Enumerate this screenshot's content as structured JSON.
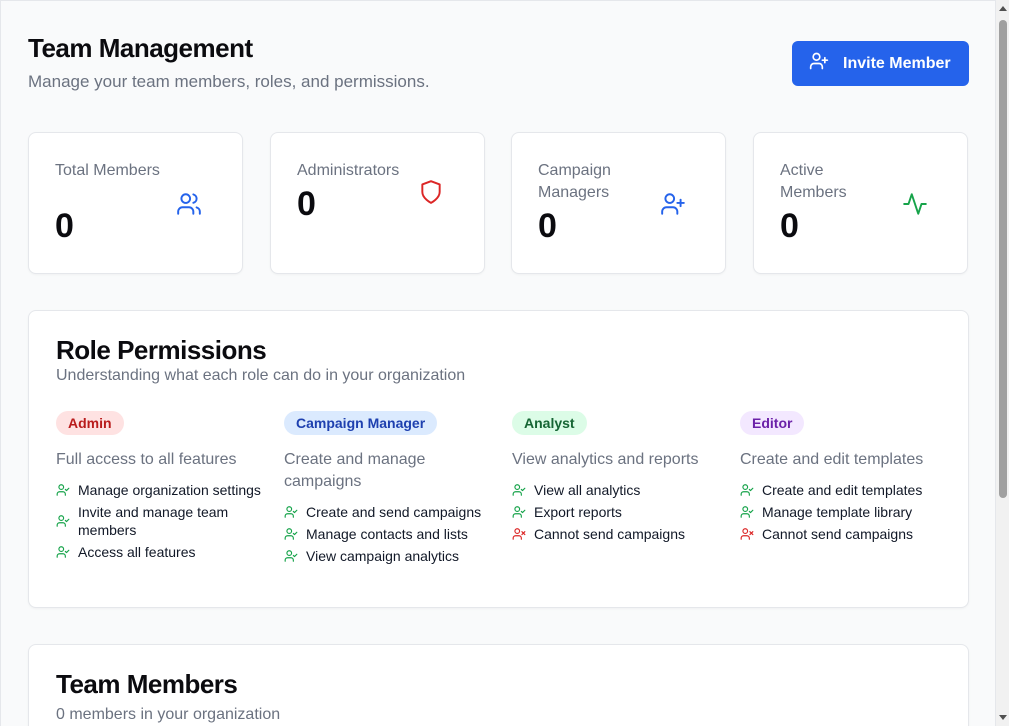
{
  "header": {
    "title": "Team Management",
    "subtitle": "Manage your team members, roles, and permissions.",
    "invite_label": "Invite Member"
  },
  "stats": [
    {
      "label": "Total Members",
      "value": "0",
      "icon": "users-icon",
      "color": "#2563eb"
    },
    {
      "label": "Administrators",
      "value": "0",
      "icon": "shield-icon",
      "color": "#dc2626"
    },
    {
      "label": "Campaign Managers",
      "value": "0",
      "icon": "user-plus-icon",
      "color": "#2563eb"
    },
    {
      "label": "Active Members",
      "value": "0",
      "icon": "activity-icon",
      "color": "#16a34a"
    }
  ],
  "roles_section": {
    "title": "Role Permissions",
    "subtitle": "Understanding what each role can do in your organization",
    "roles": [
      {
        "badge": "Admin",
        "badge_bg": "#fee2e2",
        "badge_color": "#b91c1c",
        "description": "Full access to all features",
        "permissions": [
          {
            "text": "Manage organization settings",
            "allowed": true
          },
          {
            "text": "Invite and manage team members",
            "allowed": true
          },
          {
            "text": "Access all features",
            "allowed": true
          }
        ]
      },
      {
        "badge": "Campaign Manager",
        "badge_bg": "#dbeafe",
        "badge_color": "#1e40af",
        "description": "Create and manage campaigns",
        "permissions": [
          {
            "text": "Create and send campaigns",
            "allowed": true
          },
          {
            "text": "Manage contacts and lists",
            "allowed": true
          },
          {
            "text": "View campaign analytics",
            "allowed": true
          }
        ]
      },
      {
        "badge": "Analyst",
        "badge_bg": "#dcfce7",
        "badge_color": "#166534",
        "description": "View analytics and reports",
        "permissions": [
          {
            "text": "View all analytics",
            "allowed": true
          },
          {
            "text": "Export reports",
            "allowed": true
          },
          {
            "text": "Cannot send campaigns",
            "allowed": false
          }
        ]
      },
      {
        "badge": "Editor",
        "badge_bg": "#f3e8ff",
        "badge_color": "#6b21a8",
        "description": "Create and edit templates",
        "permissions": [
          {
            "text": "Create and edit templates",
            "allowed": true
          },
          {
            "text": "Manage template library",
            "allowed": true
          },
          {
            "text": "Cannot send campaigns",
            "allowed": false
          }
        ]
      }
    ]
  },
  "members_section": {
    "title": "Team Members",
    "subtitle": "0 members in your organization"
  },
  "colors": {
    "primary": "#2563eb",
    "allowed": "#16a34a",
    "denied": "#dc2626"
  }
}
